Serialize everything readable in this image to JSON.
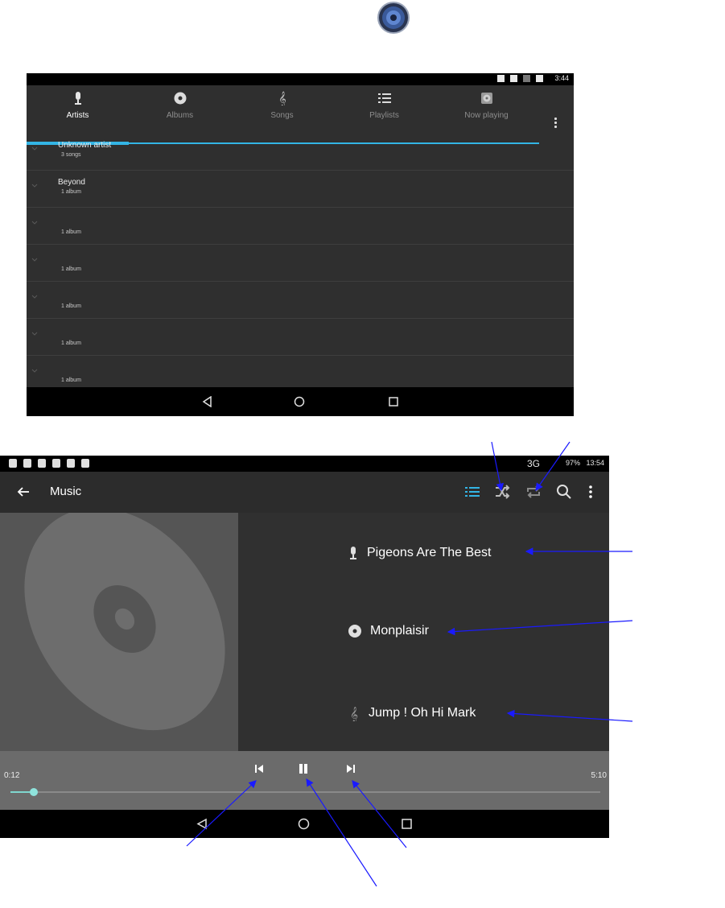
{
  "header_icon": "speaker-icon",
  "screen1": {
    "status": {
      "time": "3:44"
    },
    "tabs": [
      {
        "label": "Artists",
        "icon": "microphone-icon",
        "active": true
      },
      {
        "label": "Albums",
        "icon": "disc-icon",
        "active": false
      },
      {
        "label": "Songs",
        "icon": "music-note-icon",
        "active": false
      },
      {
        "label": "Playlists",
        "icon": "playlist-icon",
        "active": false
      },
      {
        "label": "Now playing",
        "icon": "now-playing-icon",
        "active": false
      }
    ],
    "rows": [
      {
        "title": "Unknown artist",
        "subtitle": "3 songs"
      },
      {
        "title": "Beyond",
        "subtitle": "1 album"
      },
      {
        "title": "",
        "subtitle": "1 album"
      },
      {
        "title": "",
        "subtitle": "1 album"
      },
      {
        "title": "",
        "subtitle": "1 album"
      },
      {
        "title": "",
        "subtitle": "1 album"
      },
      {
        "title": "",
        "subtitle": "1 album"
      }
    ]
  },
  "screen2": {
    "status": {
      "network": "3G",
      "battery": "97%",
      "time": "13:54"
    },
    "title": "Music",
    "artist": "Pigeons Are The Best",
    "album": "Monplaisir",
    "song": "Jump ! Oh Hi Mark",
    "elapsed": "0:12",
    "duration": "5:10",
    "progress": 0.039,
    "colors": {
      "accent": "#33b5e5",
      "progress": "#7fd6cf"
    }
  }
}
